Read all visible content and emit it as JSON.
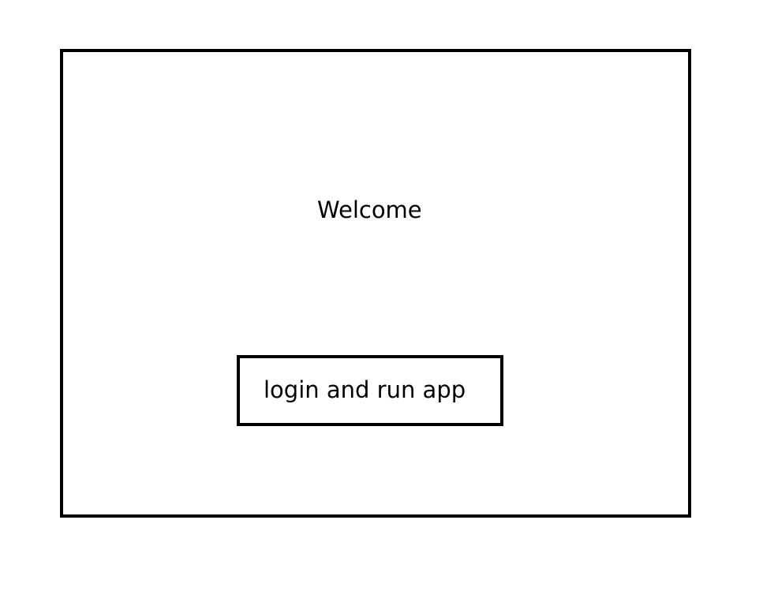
{
  "screen": {
    "welcome_text": "Welcome",
    "login_button_label": "login and run app"
  },
  "colors": {
    "border": "#000000",
    "background": "#ffffff",
    "text": "#000000"
  }
}
